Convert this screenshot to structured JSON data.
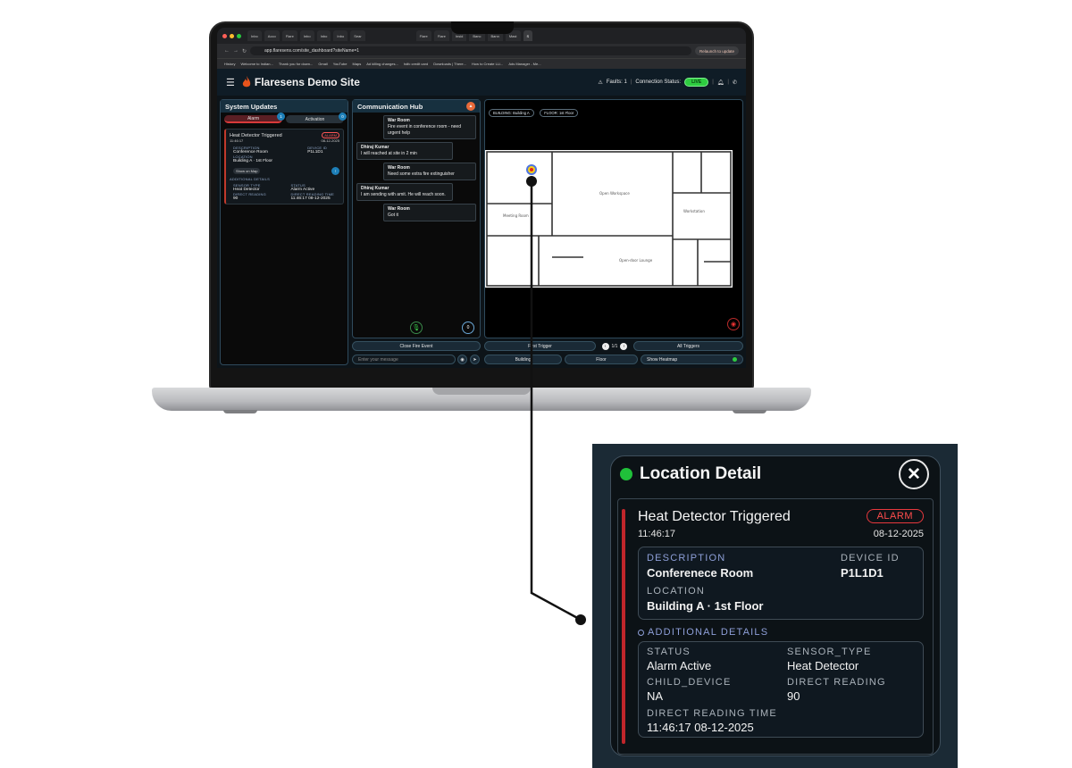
{
  "browser": {
    "tabs": [
      "Inbo",
      "Acco",
      "Flare",
      "Inbo",
      "Inbo",
      "Inbo",
      "Sear",
      "",
      "Flare",
      "Flare",
      "Insid",
      "Banc",
      "Bann",
      "Mast",
      "S"
    ],
    "url": "app.flaresens.com/site_dashboard?siteName=1",
    "relaunch": "Relaunch to update",
    "bookmarks": [
      "History",
      "Welcome to Indian...",
      "Thank you for down...",
      "Gmail",
      "YouTube",
      "Maps",
      "Ad killing changes...",
      "hdfc credit card",
      "Downloads | There...",
      "How to Create LLi...",
      "Ads Manager - Me..."
    ]
  },
  "app": {
    "site_name": "Flaresens Demo Site",
    "faults": "Faults: 1",
    "connection_label": "Connection Status:",
    "connection_value": "LIVE"
  },
  "system_updates": {
    "title": "System Updates",
    "tabs": [
      {
        "label": "Alarm",
        "count": "1"
      },
      {
        "label": "Activation",
        "count": "0"
      }
    ],
    "card": {
      "title": "Heat Detector Triggered",
      "time": "11:46:17",
      "date": "08-12-2025",
      "status_chip": "ALARM",
      "description_label": "DESCRIPTION",
      "description": "Conference Room",
      "device_label": "DEVICE ID",
      "device": "P1L1D1",
      "location_label": "LOCATION",
      "location": "Building A · 1st Floor",
      "show_on_map": "Show on Map",
      "additional": "ADDITIONAL DETAILS",
      "sensor_type_label": "SENSOR TYPE",
      "sensor_type": "Heat Detector",
      "status_label": "STATUS",
      "status": "Alarm Active",
      "reading_label": "DIRECT READING",
      "reading": "90",
      "reading_time_label": "DIRECT READING TIME",
      "reading_time": "11:46:17 08-12-2025"
    }
  },
  "comm_hub": {
    "title": "Communication Hub",
    "messages": [
      {
        "sender": "War Room",
        "text": "Fire event in conference room - need urgent help",
        "side": "right"
      },
      {
        "sender": "Dhiraj Kumar",
        "text": "I will reached at site in 2 min",
        "side": "left"
      },
      {
        "sender": "War Room",
        "text": "Need some extra fire extinguisher",
        "side": "right"
      },
      {
        "sender": "Dhiraj Kumar",
        "text": "I am sending with amit. He will reach soon.",
        "side": "left"
      },
      {
        "sender": "War Room",
        "text": "Got it",
        "side": "right"
      }
    ],
    "close_button": "Close Fire Event",
    "input_placeholder": "Enter your message",
    "count": "0"
  },
  "map": {
    "building_pill": "BUILDING: Building A",
    "floor_pill": "FLOOR: 1st Floor",
    "first_trigger": "First Trigger",
    "pager": "1/1",
    "all_triggers": "All Triggers",
    "building_btn": "Building",
    "floor_btn": "Floor",
    "heatmap_btn": "Show Heatmap"
  },
  "detail": {
    "title": "Location Detail",
    "event_title": "Heat Detector Triggered",
    "chip": "ALARM",
    "time": "11:46:17",
    "date": "08-12-2025",
    "description_label": "DESCRIPTION",
    "description": "Conferenece Room",
    "device_label": "DEVICE ID",
    "device": "P1L1D1",
    "location_label": "LOCATION",
    "location": "Building A · 1st Floor",
    "additional": "ADDITIONAL DETAILS",
    "status_label": "STATUS",
    "status": "Alarm Active",
    "sensor_label": "SENSOR_TYPE",
    "sensor": "Heat Detector",
    "child_label": "CHILD_DEVICE",
    "child": "NA",
    "reading_label": "DIRECT READING",
    "reading": "90",
    "reading_time_label": "DIRECT READING TIME",
    "reading_time": "11:46:17 08-12-2025"
  },
  "colors": {
    "live_green": "#2ecc40",
    "alarm_red": "#e8383d",
    "panel_bg": "#0a0a0a",
    "header_bg": "#0f1c26"
  }
}
